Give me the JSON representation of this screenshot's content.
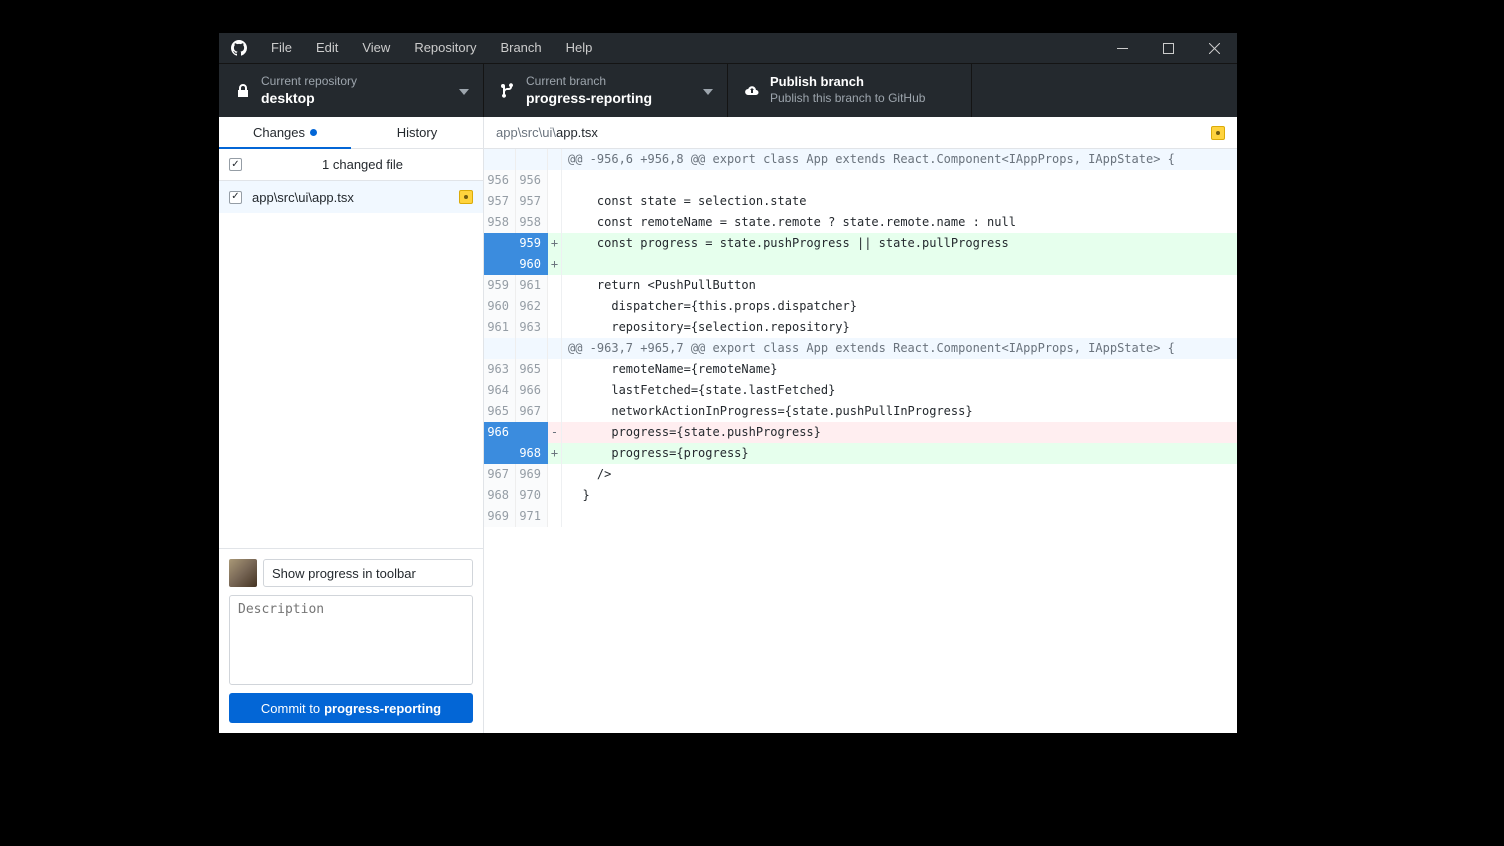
{
  "menu": {
    "items": [
      "File",
      "Edit",
      "View",
      "Repository",
      "Branch",
      "Help"
    ]
  },
  "toolbar": {
    "repo": {
      "label": "Current repository",
      "value": "desktop"
    },
    "branch": {
      "label": "Current branch",
      "value": "progress-reporting"
    },
    "publish": {
      "label": "Publish branch",
      "value": "Publish this branch to GitHub"
    }
  },
  "tabs": {
    "changes": "Changes",
    "history": "History"
  },
  "files": {
    "count_label": "1 changed file",
    "items": [
      {
        "path": "app\\src\\ui\\app.tsx"
      }
    ]
  },
  "diff_header": {
    "dir": "app\\src\\ui\\",
    "file": "app.tsx"
  },
  "commit": {
    "summary_value": "Show progress in toolbar",
    "description_placeholder": "Description",
    "button_prefix": "Commit to ",
    "button_branch": "progress-reporting"
  },
  "diff": [
    {
      "t": "hunk",
      "a": "",
      "b": "",
      "m": "",
      "c": "@@ -956,6 +956,8 @@ export class App extends React.Component<IAppProps, IAppState> {"
    },
    {
      "t": "ctx",
      "a": "956",
      "b": "956",
      "m": "",
      "c": ""
    },
    {
      "t": "ctx",
      "a": "957",
      "b": "957",
      "m": "",
      "c": "    const state = selection.state"
    },
    {
      "t": "ctx",
      "a": "958",
      "b": "958",
      "m": "",
      "c": "    const remoteName = state.remote ? state.remote.name : null"
    },
    {
      "t": "add",
      "a": "",
      "b": "959",
      "m": "+",
      "c": "    const progress = state.pushProgress || state.pullProgress",
      "sel": true
    },
    {
      "t": "add",
      "a": "",
      "b": "960",
      "m": "+",
      "c": "",
      "sel": true
    },
    {
      "t": "ctx",
      "a": "959",
      "b": "961",
      "m": "",
      "c": "    return <PushPullButton"
    },
    {
      "t": "ctx",
      "a": "960",
      "b": "962",
      "m": "",
      "c": "      dispatcher={this.props.dispatcher}"
    },
    {
      "t": "ctx",
      "a": "961",
      "b": "963",
      "m": "",
      "c": "      repository={selection.repository}"
    },
    {
      "t": "hunk",
      "a": "",
      "b": "",
      "m": "",
      "c": "@@ -963,7 +965,7 @@ export class App extends React.Component<IAppProps, IAppState> {"
    },
    {
      "t": "ctx",
      "a": "963",
      "b": "965",
      "m": "",
      "c": "      remoteName={remoteName}"
    },
    {
      "t": "ctx",
      "a": "964",
      "b": "966",
      "m": "",
      "c": "      lastFetched={state.lastFetched}"
    },
    {
      "t": "ctx",
      "a": "965",
      "b": "967",
      "m": "",
      "c": "      networkActionInProgress={state.pushPullInProgress}"
    },
    {
      "t": "del",
      "a": "966",
      "b": "",
      "m": "-",
      "c": "      progress={state.pushProgress}",
      "sel": true
    },
    {
      "t": "add",
      "a": "",
      "b": "968",
      "m": "+",
      "c": "      progress={progress}",
      "sel": true
    },
    {
      "t": "ctx",
      "a": "967",
      "b": "969",
      "m": "",
      "c": "    />"
    },
    {
      "t": "ctx",
      "a": "968",
      "b": "970",
      "m": "",
      "c": "  }"
    },
    {
      "t": "ctx",
      "a": "969",
      "b": "971",
      "m": "",
      "c": ""
    }
  ]
}
